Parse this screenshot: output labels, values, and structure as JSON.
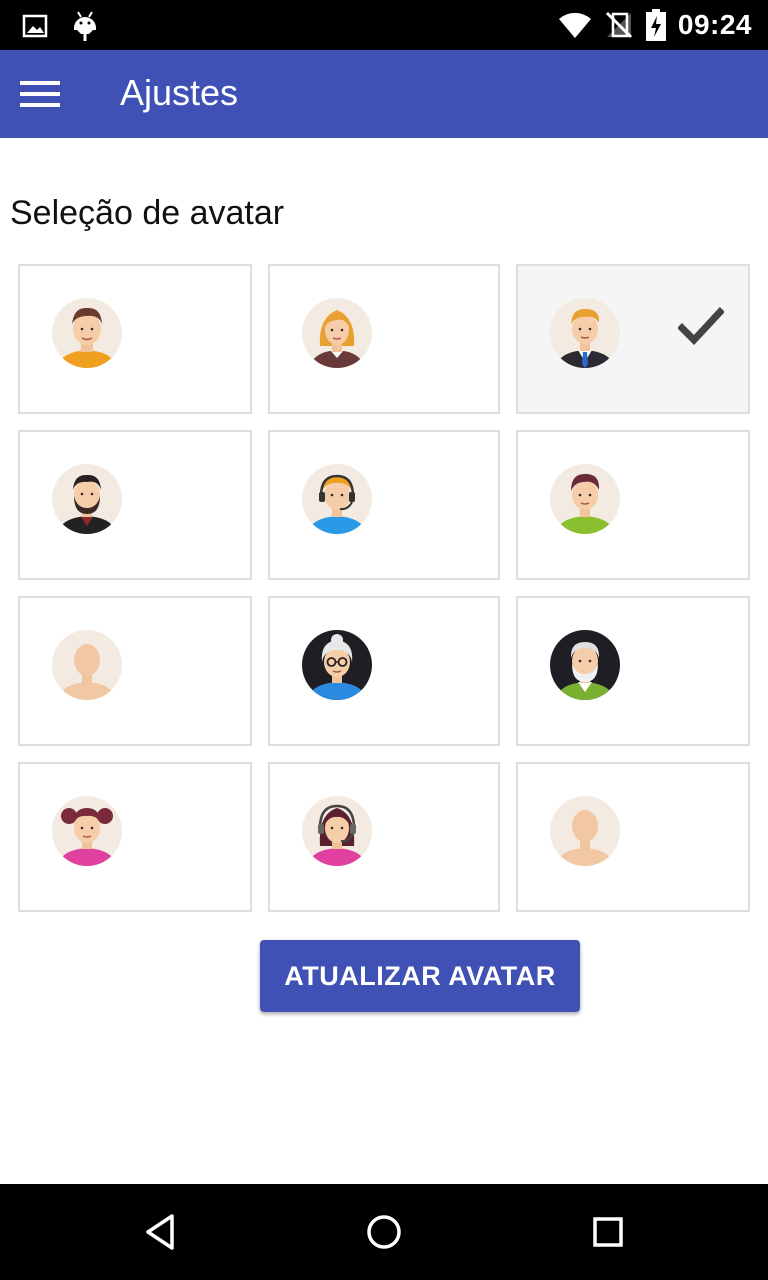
{
  "status_bar": {
    "time": "09:24",
    "icons": [
      "image-notification-icon",
      "android-debug-icon",
      "wifi-icon",
      "no-signal-icon",
      "battery-charging-icon"
    ]
  },
  "app_bar": {
    "title": "Ajustes",
    "color": "#3f51b5",
    "menu_icon": "hamburger-menu-icon"
  },
  "section": {
    "title": "Seleção de avatar"
  },
  "avatars": [
    {
      "id": "man-orange",
      "selected": false
    },
    {
      "id": "woman-blonde",
      "selected": false
    },
    {
      "id": "businessman",
      "selected": true
    },
    {
      "id": "bearded-man",
      "selected": false
    },
    {
      "id": "headset-man",
      "selected": false
    },
    {
      "id": "boy-green",
      "selected": false
    },
    {
      "id": "blank-avatar",
      "selected": false
    },
    {
      "id": "old-woman",
      "selected": false
    },
    {
      "id": "old-man",
      "selected": false
    },
    {
      "id": "girl-pigtails",
      "selected": false
    },
    {
      "id": "headset-woman",
      "selected": false
    },
    {
      "id": "blank-avatar-2",
      "selected": false
    }
  ],
  "update_button": {
    "label": "ATUALIZAR AVATAR"
  },
  "nav_bar": {
    "icons": [
      "back-icon",
      "home-icon",
      "recents-icon"
    ]
  }
}
